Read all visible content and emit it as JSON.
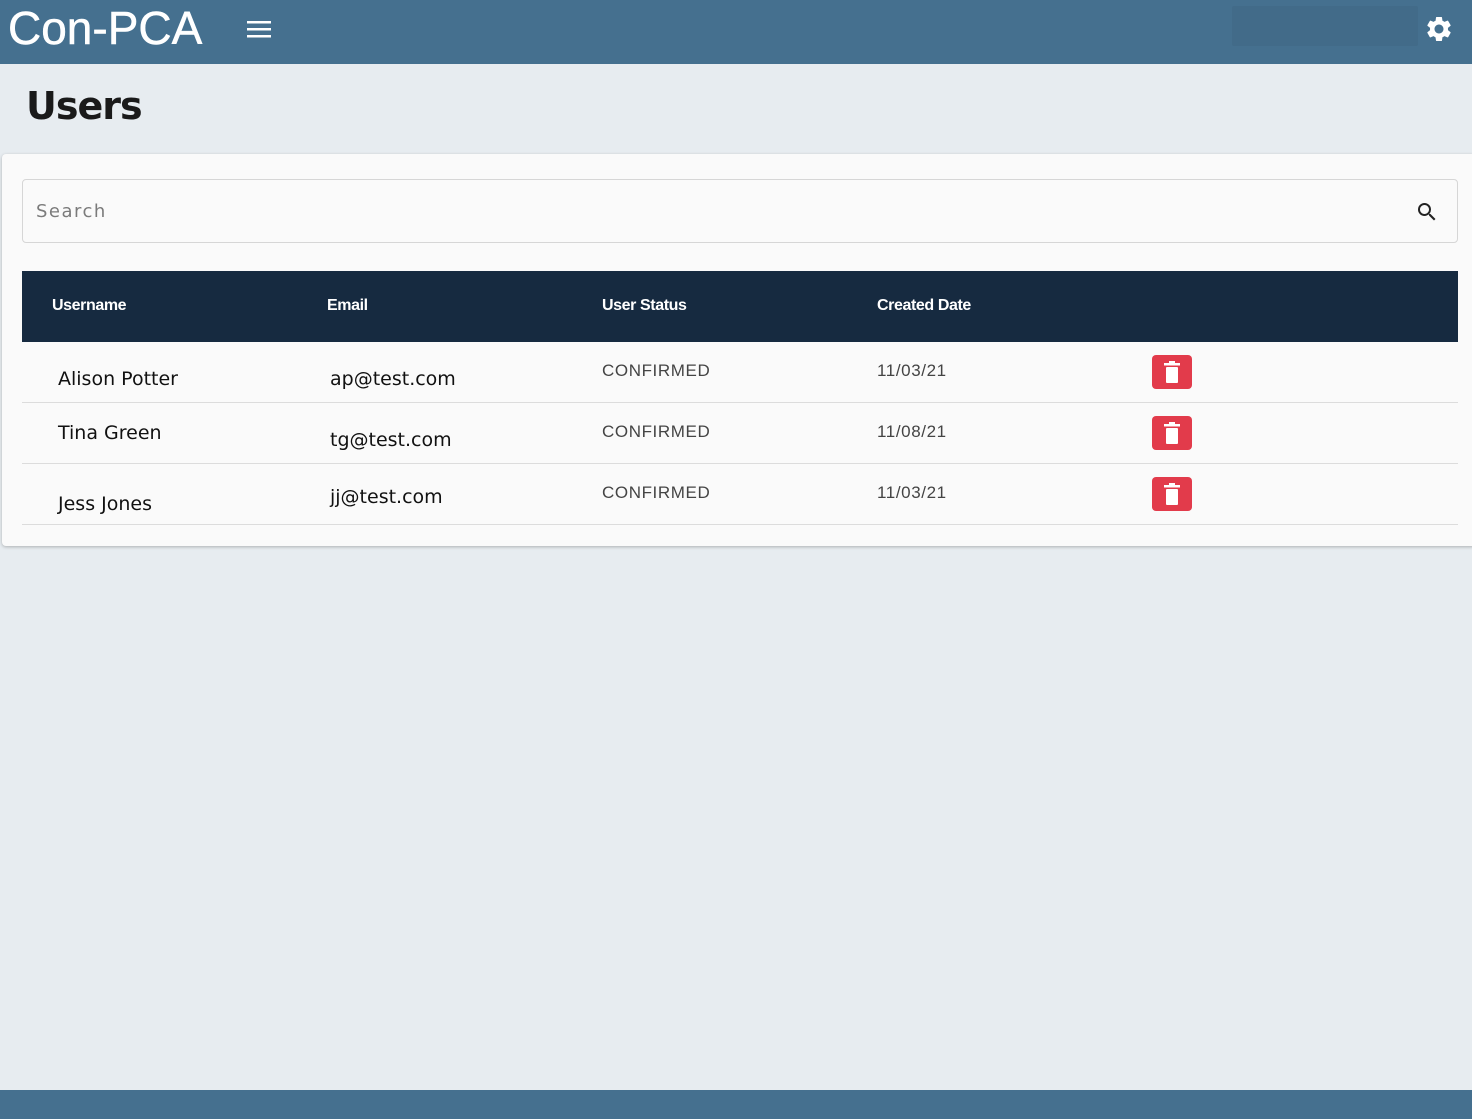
{
  "header": {
    "logo_text": "Con-PCA",
    "menu_icon": "hamburger-menu-icon",
    "settings_icon": "gear-icon",
    "accent_color": "#45708f"
  },
  "page": {
    "title": "Users"
  },
  "search": {
    "placeholder": "Search",
    "value": "",
    "icon": "search-icon"
  },
  "table": {
    "header_color": "#162a40",
    "columns": [
      "Username",
      "Email",
      "User Status",
      "Created Date"
    ],
    "rows": [
      {
        "username": "Alison Potter",
        "email": "ap@test.com",
        "status": "CONFIRMED",
        "created": "11/03/21"
      },
      {
        "username": "Tina Green",
        "email": "tg@test.com",
        "status": "CONFIRMED",
        "created": "11/08/21"
      },
      {
        "username": "Jess Jones",
        "email": "jj@test.com",
        "status": "CONFIRMED",
        "created": "11/03/21"
      }
    ],
    "delete_icon": "trash-icon",
    "delete_color": "#e23b4b"
  }
}
